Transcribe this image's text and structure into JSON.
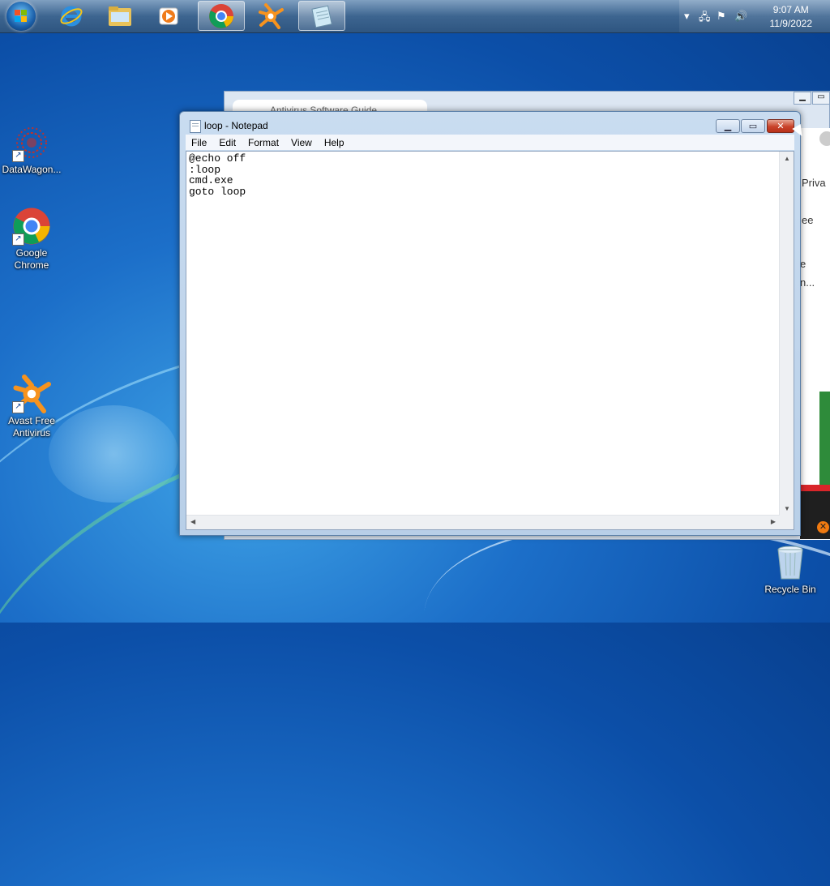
{
  "taskbar": {
    "pinned": [
      {
        "name": "internet-explorer-icon"
      },
      {
        "name": "file-explorer-icon"
      },
      {
        "name": "media-player-icon"
      },
      {
        "name": "chrome-icon"
      },
      {
        "name": "avast-icon"
      },
      {
        "name": "notepad-icon"
      }
    ],
    "clock": {
      "time": "9:07 AM",
      "date": "11/9/2022"
    }
  },
  "desktop": {
    "icons": [
      {
        "label": "DataWagon..."
      },
      {
        "label": "Google Chrome"
      },
      {
        "label": "Avast Free Antivirus"
      },
      {
        "label": "Recycle Bin"
      }
    ]
  },
  "browser_bg": {
    "tab_title": "Antivirus Software Guide",
    "visible_text": [
      "Priva",
      "ee",
      "e",
      "n..."
    ]
  },
  "notepad": {
    "title": "loop - Notepad",
    "menu": [
      "File",
      "Edit",
      "Format",
      "View",
      "Help"
    ],
    "content": "@echo off\n:loop\ncmd.exe\ngoto loop",
    "controls": {
      "minimize": "▁",
      "maximize": "▭",
      "close": "✕"
    }
  },
  "colors": {
    "desktop_bg": "#1c6fc9",
    "taskbar": "#3d6590",
    "close_button": "#c8432a"
  }
}
